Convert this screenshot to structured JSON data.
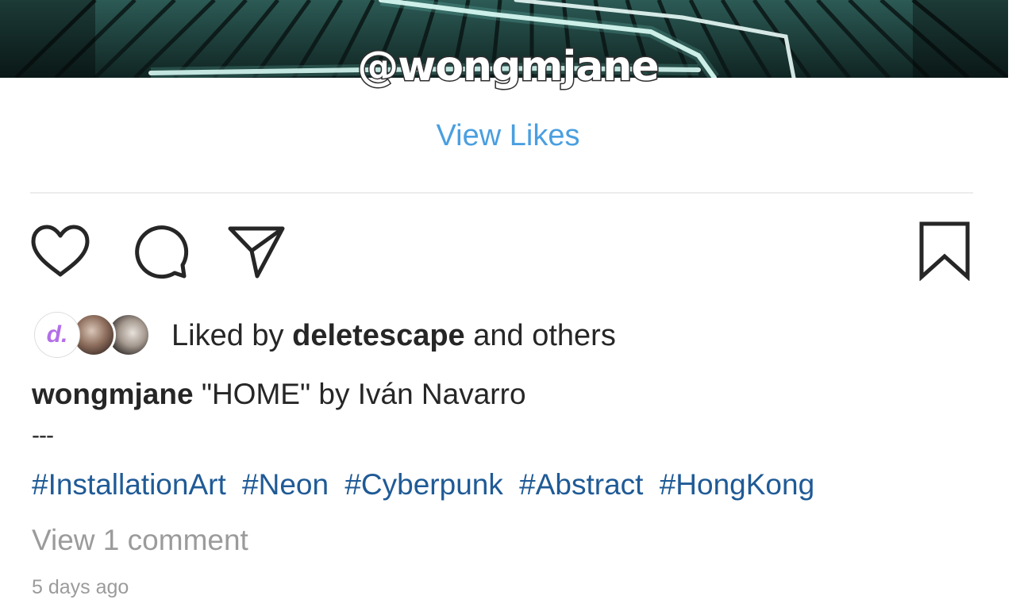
{
  "post": {
    "watermark": "@wongmjane",
    "view_likes_label": "View Likes",
    "actions": {
      "like_icon": "heart-icon",
      "comment_icon": "comment-icon",
      "share_icon": "send-icon",
      "save_icon": "bookmark-icon"
    },
    "liked_by": {
      "avatar_1_letter": "d.",
      "prefix": "Liked by",
      "user": "deletescape",
      "suffix": "and others"
    },
    "caption": {
      "username": "wongmjane",
      "text": "\"HOME\" by Iván Navarro"
    },
    "separator": "---",
    "hashtags": [
      "#InstallationArt",
      "#Neon",
      "#Cyberpunk",
      "#Abstract",
      "#HongKong"
    ],
    "view_comments_label": "View 1 comment",
    "timestamp": "5 days ago"
  },
  "colors": {
    "link_blue": "#4a9fe0",
    "hashtag_blue": "#1f5a96",
    "muted_gray": "#9b9b9b",
    "text": "#262626"
  }
}
